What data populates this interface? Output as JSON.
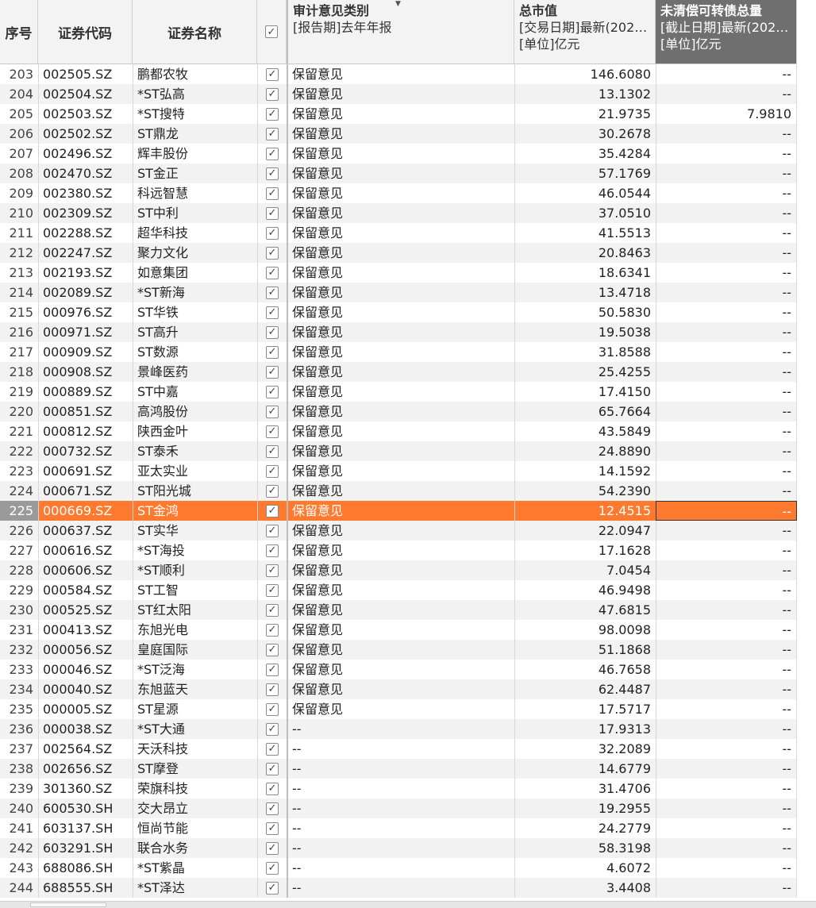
{
  "header": {
    "idx": "序号",
    "code": "证券代码",
    "name": "证券名称",
    "check_icon": "checkbox-checked-icon",
    "audit": {
      "title": "审计意见类别",
      "line2": "[报告期]去年年报"
    },
    "market_value": {
      "title": "总市值",
      "line2": "[交易日期]最新(202…",
      "line3": "[单位]亿元"
    },
    "convertible": {
      "title": "未清偿可转债总量",
      "line2": "[截止日期]最新(202…",
      "line3": "[单位]亿元"
    }
  },
  "colors": {
    "selected_row": "#ff7a2e",
    "dark_header": "#6f6f6f"
  },
  "selected_index": 22,
  "rows": [
    {
      "idx": "203",
      "code": "002505.SZ",
      "name": "鹏都农牧",
      "audit": "保留意见",
      "mv": "146.6080",
      "cb": "--"
    },
    {
      "idx": "204",
      "code": "002504.SZ",
      "name": "*ST弘高",
      "audit": "保留意见",
      "mv": "13.1302",
      "cb": "--"
    },
    {
      "idx": "205",
      "code": "002503.SZ",
      "name": "*ST搜特",
      "audit": "保留意见",
      "mv": "21.9735",
      "cb": "7.9810"
    },
    {
      "idx": "206",
      "code": "002502.SZ",
      "name": "ST鼎龙",
      "audit": "保留意见",
      "mv": "30.2678",
      "cb": "--"
    },
    {
      "idx": "207",
      "code": "002496.SZ",
      "name": "辉丰股份",
      "audit": "保留意见",
      "mv": "35.4284",
      "cb": "--"
    },
    {
      "idx": "208",
      "code": "002470.SZ",
      "name": "ST金正",
      "audit": "保留意见",
      "mv": "57.1769",
      "cb": "--"
    },
    {
      "idx": "209",
      "code": "002380.SZ",
      "name": "科远智慧",
      "audit": "保留意见",
      "mv": "46.0544",
      "cb": "--"
    },
    {
      "idx": "210",
      "code": "002309.SZ",
      "name": "ST中利",
      "audit": "保留意见",
      "mv": "37.0510",
      "cb": "--"
    },
    {
      "idx": "211",
      "code": "002288.SZ",
      "name": "超华科技",
      "audit": "保留意见",
      "mv": "41.5513",
      "cb": "--"
    },
    {
      "idx": "212",
      "code": "002247.SZ",
      "name": "聚力文化",
      "audit": "保留意见",
      "mv": "20.8463",
      "cb": "--"
    },
    {
      "idx": "213",
      "code": "002193.SZ",
      "name": "如意集团",
      "audit": "保留意见",
      "mv": "18.6341",
      "cb": "--"
    },
    {
      "idx": "214",
      "code": "002089.SZ",
      "name": "*ST新海",
      "audit": "保留意见",
      "mv": "13.4718",
      "cb": "--"
    },
    {
      "idx": "215",
      "code": "000976.SZ",
      "name": "ST华铁",
      "audit": "保留意见",
      "mv": "50.5830",
      "cb": "--"
    },
    {
      "idx": "216",
      "code": "000971.SZ",
      "name": "ST高升",
      "audit": "保留意见",
      "mv": "19.5038",
      "cb": "--"
    },
    {
      "idx": "217",
      "code": "000909.SZ",
      "name": "ST数源",
      "audit": "保留意见",
      "mv": "31.8588",
      "cb": "--"
    },
    {
      "idx": "218",
      "code": "000908.SZ",
      "name": "景峰医药",
      "audit": "保留意见",
      "mv": "25.4255",
      "cb": "--"
    },
    {
      "idx": "219",
      "code": "000889.SZ",
      "name": "ST中嘉",
      "audit": "保留意见",
      "mv": "17.4150",
      "cb": "--"
    },
    {
      "idx": "220",
      "code": "000851.SZ",
      "name": "高鸿股份",
      "audit": "保留意见",
      "mv": "65.7664",
      "cb": "--"
    },
    {
      "idx": "221",
      "code": "000812.SZ",
      "name": "陕西金叶",
      "audit": "保留意见",
      "mv": "43.5849",
      "cb": "--"
    },
    {
      "idx": "222",
      "code": "000732.SZ",
      "name": "ST泰禾",
      "audit": "保留意见",
      "mv": "24.8890",
      "cb": "--"
    },
    {
      "idx": "223",
      "code": "000691.SZ",
      "name": "亚太实业",
      "audit": "保留意见",
      "mv": "14.1592",
      "cb": "--"
    },
    {
      "idx": "224",
      "code": "000671.SZ",
      "name": "ST阳光城",
      "audit": "保留意见",
      "mv": "54.2390",
      "cb": "--"
    },
    {
      "idx": "225",
      "code": "000669.SZ",
      "name": "ST金鸿",
      "audit": "保留意见",
      "mv": "12.4515",
      "cb": "--"
    },
    {
      "idx": "226",
      "code": "000637.SZ",
      "name": "ST实华",
      "audit": "保留意见",
      "mv": "22.0947",
      "cb": "--"
    },
    {
      "idx": "227",
      "code": "000616.SZ",
      "name": "*ST海投",
      "audit": "保留意见",
      "mv": "17.1628",
      "cb": "--"
    },
    {
      "idx": "228",
      "code": "000606.SZ",
      "name": "*ST顺利",
      "audit": "保留意见",
      "mv": "7.0454",
      "cb": "--"
    },
    {
      "idx": "229",
      "code": "000584.SZ",
      "name": "ST工智",
      "audit": "保留意见",
      "mv": "46.9498",
      "cb": "--"
    },
    {
      "idx": "230",
      "code": "000525.SZ",
      "name": "ST红太阳",
      "audit": "保留意见",
      "mv": "47.6815",
      "cb": "--"
    },
    {
      "idx": "231",
      "code": "000413.SZ",
      "name": "东旭光电",
      "audit": "保留意见",
      "mv": "98.0098",
      "cb": "--"
    },
    {
      "idx": "232",
      "code": "000056.SZ",
      "name": "皇庭国际",
      "audit": "保留意见",
      "mv": "51.1868",
      "cb": "--"
    },
    {
      "idx": "233",
      "code": "000046.SZ",
      "name": "*ST泛海",
      "audit": "保留意见",
      "mv": "46.7658",
      "cb": "--"
    },
    {
      "idx": "234",
      "code": "000040.SZ",
      "name": "东旭蓝天",
      "audit": "保留意见",
      "mv": "62.4487",
      "cb": "--"
    },
    {
      "idx": "235",
      "code": "000005.SZ",
      "name": "ST星源",
      "audit": "保留意见",
      "mv": "17.5717",
      "cb": "--"
    },
    {
      "idx": "236",
      "code": "000038.SZ",
      "name": "*ST大通",
      "audit": "--",
      "mv": "17.9313",
      "cb": "--"
    },
    {
      "idx": "237",
      "code": "002564.SZ",
      "name": "天沃科技",
      "audit": "--",
      "mv": "32.2089",
      "cb": "--"
    },
    {
      "idx": "238",
      "code": "002656.SZ",
      "name": "ST摩登",
      "audit": "--",
      "mv": "14.6779",
      "cb": "--"
    },
    {
      "idx": "239",
      "code": "301360.SZ",
      "name": "荣旗科技",
      "audit": "--",
      "mv": "31.4706",
      "cb": "--"
    },
    {
      "idx": "240",
      "code": "600530.SH",
      "name": "交大昂立",
      "audit": "--",
      "mv": "19.2955",
      "cb": "--"
    },
    {
      "idx": "241",
      "code": "603137.SH",
      "name": "恒尚节能",
      "audit": "--",
      "mv": "24.2779",
      "cb": "--"
    },
    {
      "idx": "242",
      "code": "603291.SH",
      "name": "联合水务",
      "audit": "--",
      "mv": "58.3198",
      "cb": "--"
    },
    {
      "idx": "243",
      "code": "688086.SH",
      "name": "*ST紫晶",
      "audit": "--",
      "mv": "4.6072",
      "cb": "--"
    },
    {
      "idx": "244",
      "code": "688555.SH",
      "name": "*ST泽达",
      "audit": "--",
      "mv": "3.4408",
      "cb": "--"
    }
  ]
}
